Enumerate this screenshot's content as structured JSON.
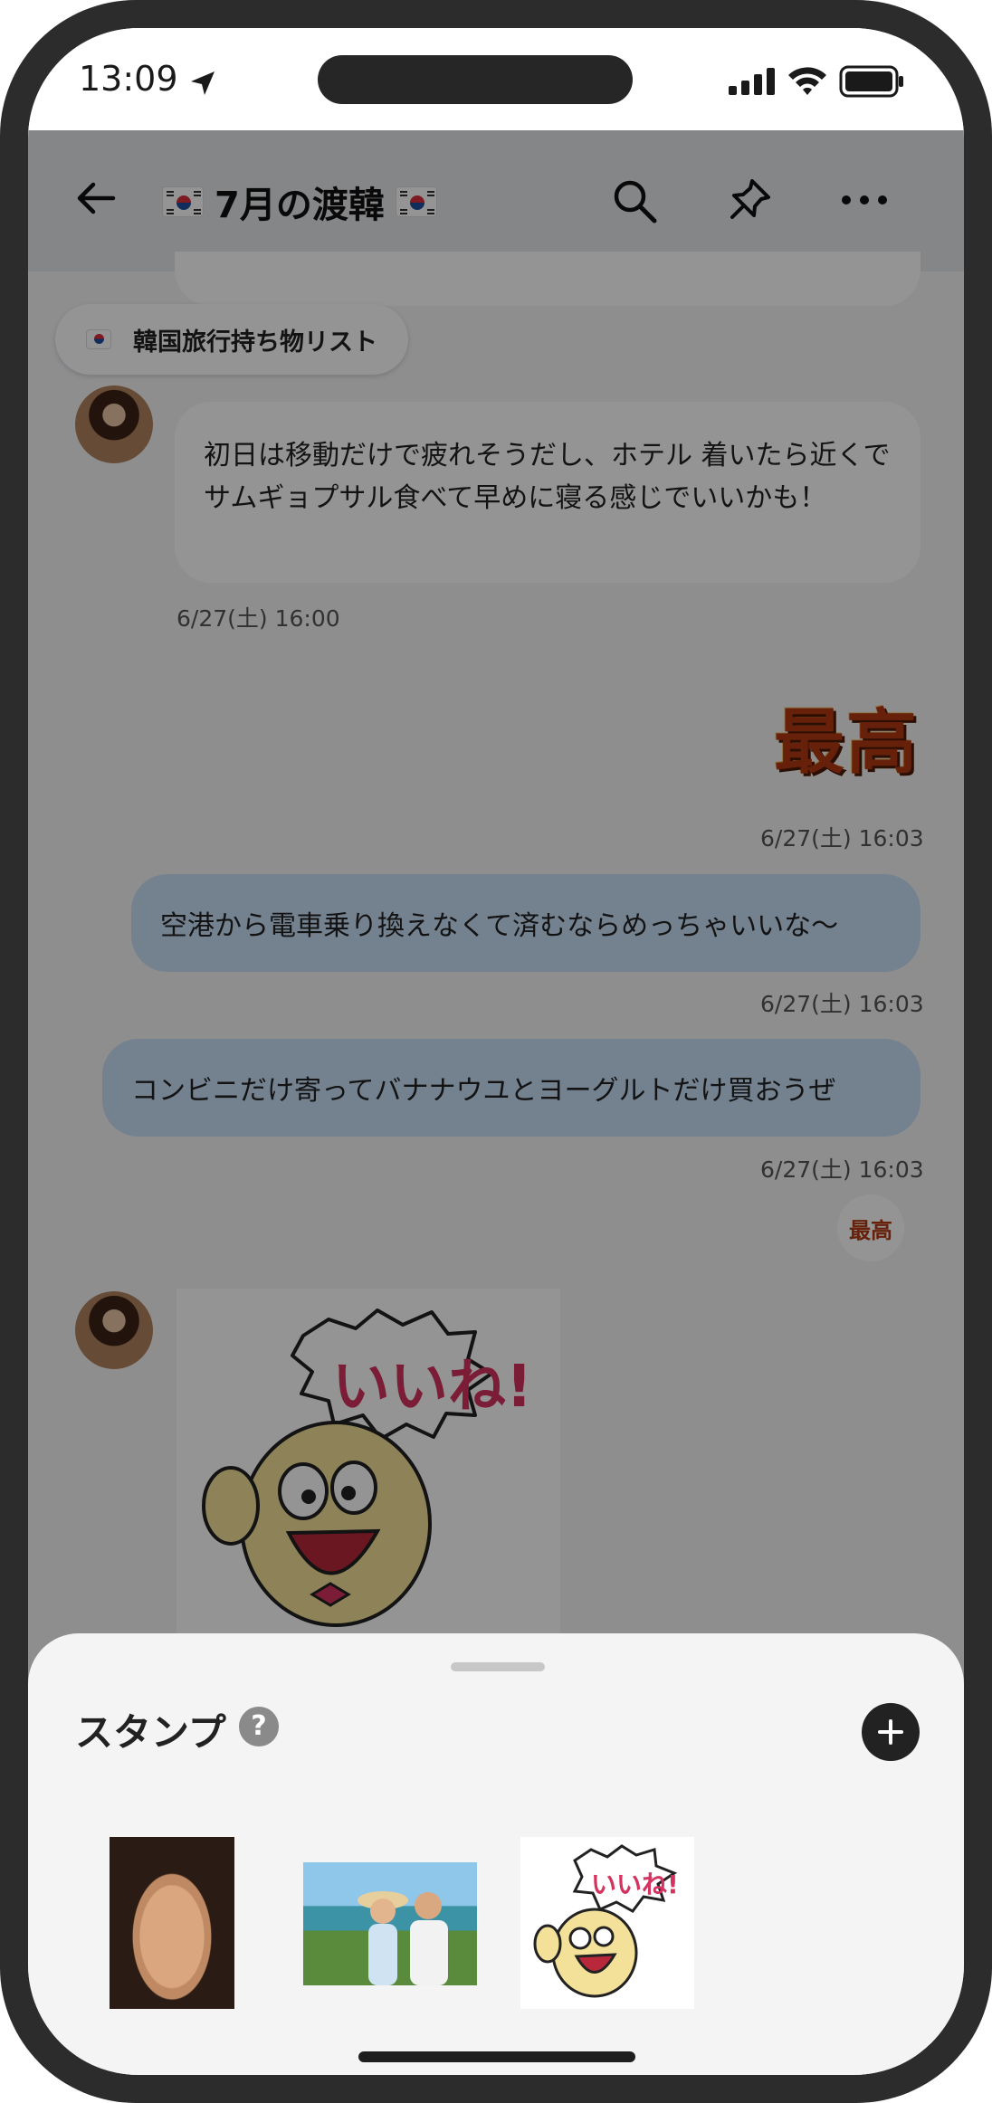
{
  "status_bar": {
    "time": "13:09"
  },
  "header": {
    "title": "7月の渡韓"
  },
  "pinned": {
    "label": "韓国旅行持ち物リスト"
  },
  "messages": {
    "incoming_1": {
      "text": "初日は移動だけで疲れそうだし、ホテル 着いたら近くでサムギョプサル食べて早めに寝る感じでいいかも！",
      "timestamp": "6/27(土) 16:00"
    },
    "sticker_saikou": {
      "text": "最高",
      "timestamp": "6/27(土) 16:03"
    },
    "outgoing_1": {
      "text": "空港から電車乗り換えなくて済むならめっちゃいいな〜",
      "timestamp": "6/27(土) 16:03"
    },
    "outgoing_2": {
      "text": "コンビニだけ寄ってバナナウユとヨーグルトだけ買おうぜ",
      "timestamp": "6/27(土) 16:03"
    },
    "reaction": {
      "text": "最高"
    },
    "sticker_iine": {
      "text": "いいね!"
    }
  },
  "stamp_sheet": {
    "title": "スタンプ",
    "help": "?",
    "thumb_sticker_text": "いいね!"
  },
  "colors": {
    "outgoing_bubble": "#c9dff6",
    "incoming_bubble": "#ffffff",
    "background": "#f4f5f7",
    "sheet": "#f4f4f4"
  }
}
